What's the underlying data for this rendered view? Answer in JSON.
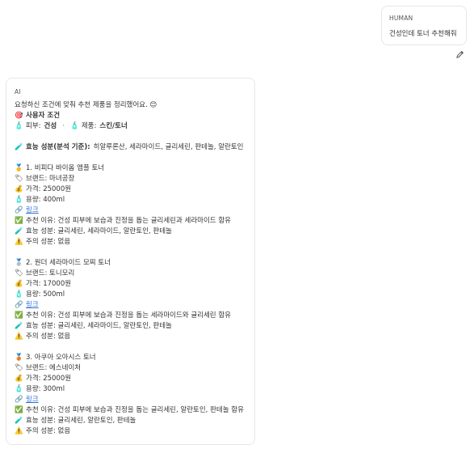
{
  "human": {
    "role_label": "HUMAN",
    "message": "건성인데 토너 추천해줘"
  },
  "ai": {
    "role_label": "AI",
    "intro": "요청하신 조건에 맞춰 추천 제품을 정리했어요. 😊",
    "conditions_title": "사용자 조건",
    "skin_label": "피부:",
    "skin_value": "건성",
    "category_label": "제품:",
    "category_value": "스킨/토너",
    "separator": "·",
    "ingredients_label": "효능 성분(분석 기준):",
    "ingredients_value": "히알루론산, 세라마이드, 글리세린, 판테놀, 알란토인",
    "products": [
      {
        "title": "1. 비피다 바이옴 앰플 토너",
        "brand": "브랜드: 마녀공장",
        "price": "가격: 25000원",
        "volume": "용량: 400ml",
        "link": "링크",
        "reason": "추천 이유: 건성 피부에 보습과 진정을 돕는 글리세린과 세라마이드 함유",
        "active": "효능 성분: 글리세린, 세라마이드, 알란토인, 판테놀",
        "caution": "주의 성분: 없음"
      },
      {
        "title": "2. 원더 세라마이드 모찌 토너",
        "brand": "브랜드: 토니모리",
        "price": "가격: 17000원",
        "volume": "용량: 500ml",
        "link": "링크",
        "reason": "추천 이유: 건성 피부에 보습과 진정을 돕는 세라마이드와 글리세린 함유",
        "active": "효능 성분: 글리세린, 세라마이드, 알란토인, 판테놀",
        "caution": "주의 성분: 없음"
      },
      {
        "title": "3. 아쿠아 오아시스 토너",
        "brand": "브랜드: 에스네이처",
        "price": "가격: 25000원",
        "volume": "용량: 300ml",
        "link": "링크",
        "reason": "추천 이유: 건성 피부에 보습과 진정을 돕는 글리세린, 알란토인, 판테놀 함유",
        "active": "효능 성분: 글리세린, 알란토인, 판테놀",
        "caution": "주의 성분: 없음"
      }
    ]
  },
  "icons": {
    "target": "🎯",
    "skin": "🧴",
    "bottle": "🧴",
    "dropper": "🧪",
    "medal_1": "🥇",
    "medal_2": "🥈",
    "medal_3": "🥉",
    "brand": "🏷",
    "price": "💰",
    "volume": "🧴",
    "link": "🔗",
    "check": "✅",
    "warning": "⚠️"
  },
  "colors": {
    "link": "#2f6fd6",
    "border": "#e6e6e6"
  }
}
